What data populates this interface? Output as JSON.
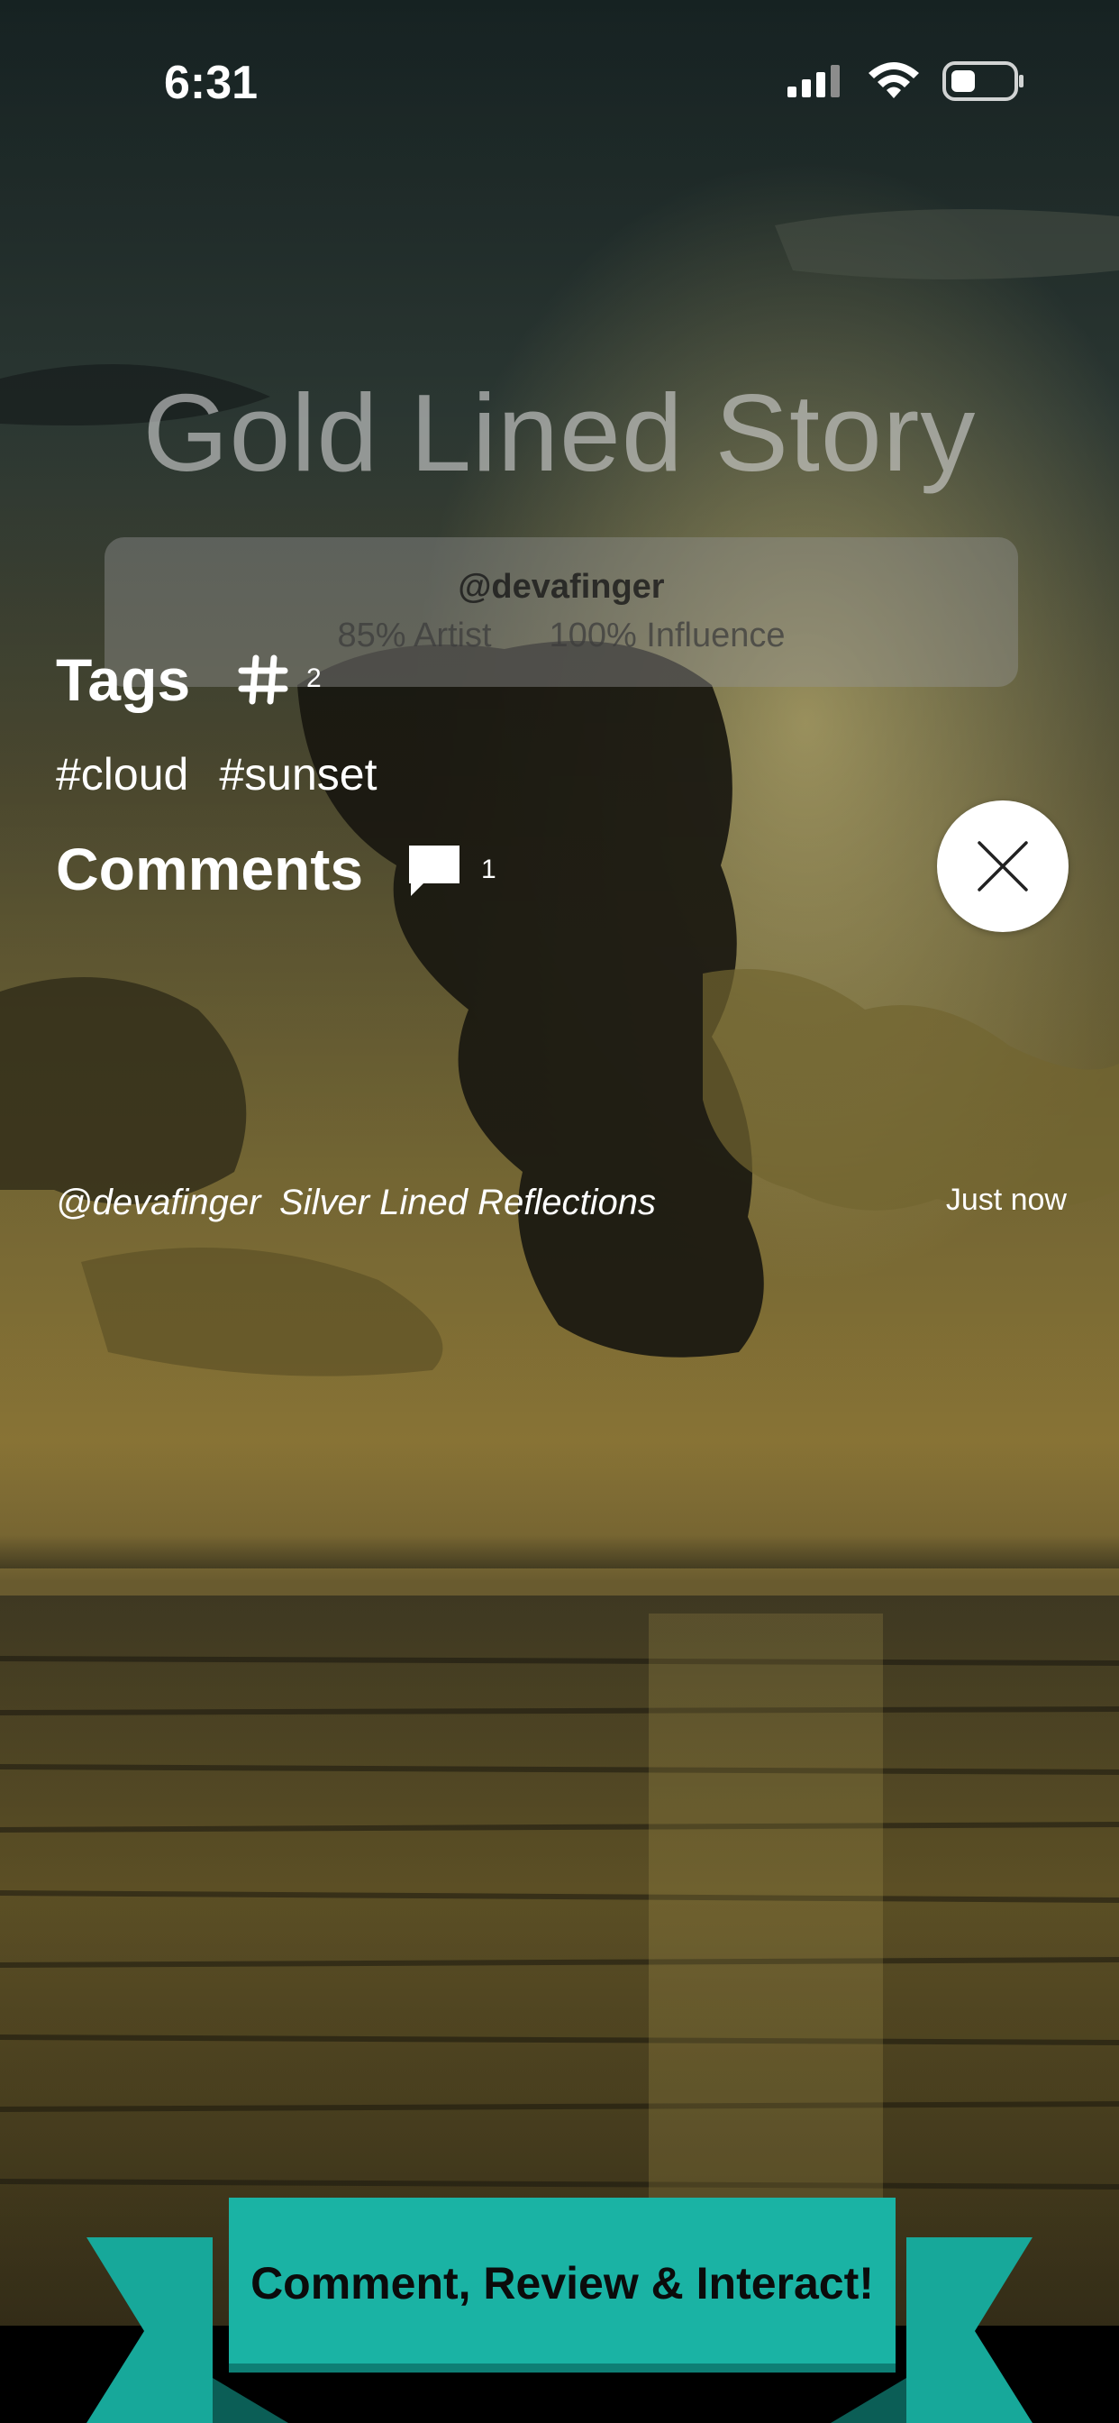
{
  "status_bar": {
    "time": "6:31"
  },
  "story": {
    "title": "Gold Lined Story"
  },
  "author": {
    "handle": "@devafinger",
    "artist_stat": "85% Artist",
    "influence_stat": "100% Influence"
  },
  "tags": {
    "label": "Tags",
    "count": "2",
    "items": [
      "#cloud",
      "#sunset"
    ]
  },
  "comments": {
    "label": "Comments",
    "count": "1",
    "items": [
      {
        "user": "@devafinger",
        "text": "Silver Lined Reflections",
        "time": "Just now"
      }
    ]
  },
  "banner": {
    "text": "Comment, Review & Interact!"
  },
  "colors": {
    "banner_teal": "#17a89a",
    "banner_dark_teal": "#0e7f75",
    "text_white": "#ffffff"
  },
  "icons": {
    "signal": "cellular-signal-icon",
    "wifi": "wifi-icon",
    "battery": "battery-icon",
    "hash": "hash-icon",
    "comment": "comment-bubble-icon",
    "close": "close-icon"
  }
}
